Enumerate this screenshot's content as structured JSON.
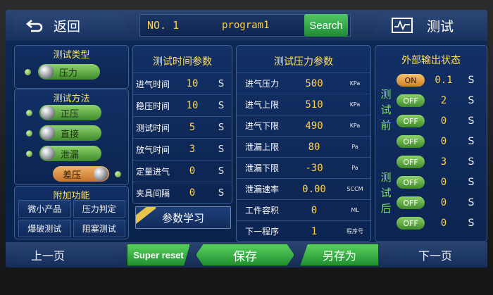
{
  "header": {
    "back_label": "返回",
    "program_no": "NO. 1",
    "program_name": "program1",
    "search_label": "Search",
    "test_label": "测试"
  },
  "test_type": {
    "title": "测试类型",
    "selected": "压力"
  },
  "test_method": {
    "title": "测试方法",
    "options": [
      "正压",
      "直接",
      "泄漏"
    ],
    "diff_pressure": "差压"
  },
  "extra_functions": {
    "title": "附加功能",
    "items": [
      "微小产品",
      "压力判定",
      "爆破测试",
      "阻塞测试"
    ]
  },
  "time_params": {
    "title": "测试时间参数",
    "rows": [
      {
        "name": "进气时间",
        "value": "10",
        "unit": "S"
      },
      {
        "name": "稳压时间",
        "value": "10",
        "unit": "S"
      },
      {
        "name": "测试时间",
        "value": "5",
        "unit": "S"
      },
      {
        "name": "放气时间",
        "value": "3",
        "unit": "S"
      },
      {
        "name": "定量进气",
        "value": "0",
        "unit": "S"
      },
      {
        "name": "夹具间隔",
        "value": "0",
        "unit": "S"
      }
    ],
    "learn_label": "参数学习"
  },
  "pressure_params": {
    "title": "测试压力参数",
    "rows": [
      {
        "name": "进气压力",
        "value": "500",
        "unit": "KPa"
      },
      {
        "name": "进气上限",
        "value": "510",
        "unit": "KPa"
      },
      {
        "name": "进气下限",
        "value": "490",
        "unit": "KPa"
      },
      {
        "name": "泄漏上限",
        "value": "80",
        "unit": "Pa"
      },
      {
        "name": "泄漏下限",
        "value": "-30",
        "unit": "Pa"
      },
      {
        "name": "泄漏速率",
        "value": "0.00",
        "unit": "SCCM"
      },
      {
        "name": "工件容积",
        "value": "0",
        "unit": "ML"
      },
      {
        "name": "下一程序",
        "value": "1",
        "unit": "程序号"
      }
    ]
  },
  "output_status": {
    "title": "外部输出状态",
    "before_label": "测试前",
    "after_label": "测试后",
    "before": [
      {
        "state": "ON",
        "value": "0.1",
        "unit": "S"
      },
      {
        "state": "OFF",
        "value": "2",
        "unit": "S"
      },
      {
        "state": "OFF",
        "value": "0",
        "unit": "S"
      },
      {
        "state": "OFF",
        "value": "0",
        "unit": "S"
      }
    ],
    "after": [
      {
        "state": "OFF",
        "value": "3",
        "unit": "S"
      },
      {
        "state": "OFF",
        "value": "0",
        "unit": "S"
      },
      {
        "state": "OFF",
        "value": "0",
        "unit": "S"
      },
      {
        "state": "OFF",
        "value": "0",
        "unit": "S"
      }
    ]
  },
  "footer": {
    "prev_label": "上一页",
    "super_reset_label": "Super reset",
    "save_label": "保存",
    "save_as_label": "另存为",
    "next_label": "下一页"
  }
}
